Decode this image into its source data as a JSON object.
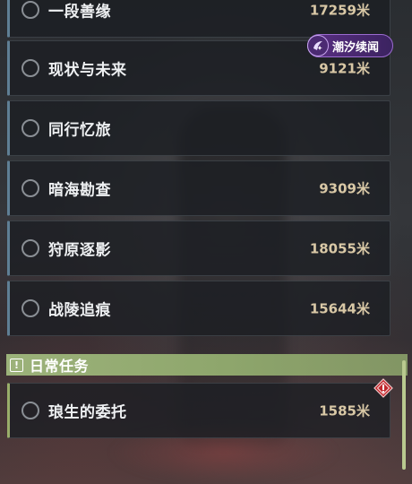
{
  "quests": [
    {
      "name": "一段善缘",
      "distance": "17259米"
    },
    {
      "name": "现状与未来",
      "distance": "9121米"
    },
    {
      "name": "同行忆旅",
      "distance": ""
    },
    {
      "name": "暗海勘查",
      "distance": "9309米"
    },
    {
      "name": "狩原逐影",
      "distance": "18055米"
    },
    {
      "name": "战陵追痕",
      "distance": "15644米"
    }
  ],
  "event_badge": {
    "label": "潮汐续闻",
    "icon": "tide-event-icon",
    "color": "#5a2f83"
  },
  "daily_section": {
    "title": "日常任务",
    "icon": "exclamation-box-icon",
    "color": "#9cb27a",
    "quests": [
      {
        "name": "琅生的委托",
        "distance": "1585米",
        "alert_icon": "red-diamond-alert-icon"
      }
    ]
  }
}
